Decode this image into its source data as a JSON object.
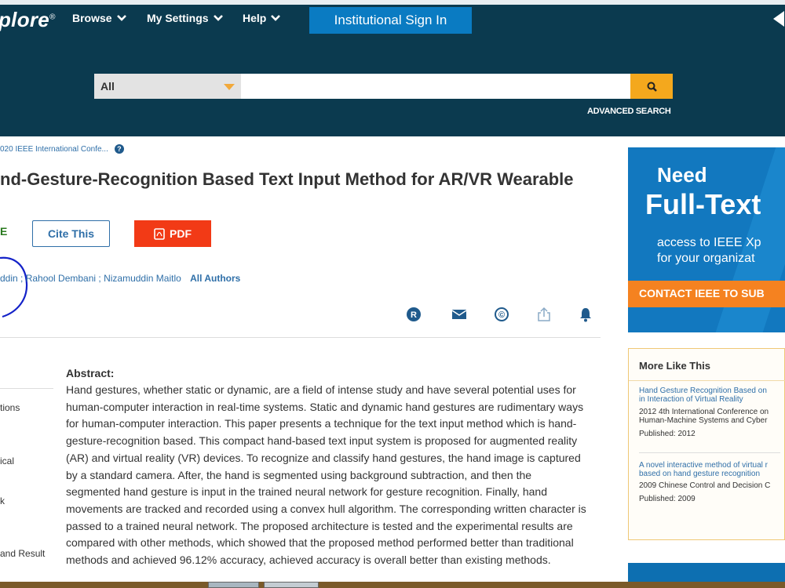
{
  "header": {
    "logo_text": "plore",
    "logo_mark": "®",
    "nav": [
      {
        "label": "Browse"
      },
      {
        "label": "My Settings"
      },
      {
        "label": "Help"
      }
    ],
    "signin_label": "Institutional Sign In",
    "search": {
      "scope_value": "All",
      "query_value": "",
      "advanced_label": "ADVANCED SEARCH"
    }
  },
  "breadcrumb": "020 IEEE International Confe...",
  "help_glyph": "?",
  "article": {
    "title": "nd-Gesture-Recognition Based Text Input Method for AR/VR Wearable",
    "access_label": "E",
    "cite_label": "Cite This",
    "pdf_label": "PDF",
    "authors": "ddin ; Rahool Dembani ; Nizamuddin Maitlo",
    "all_authors_label": "All Authors",
    "icons": [
      "rights-icon",
      "email-icon",
      "copyright-icon",
      "share-icon",
      "alert-bell-icon"
    ],
    "rights_glyph": "R",
    "copyright_glyph": "©"
  },
  "left_nav": [
    {
      "label": "tions"
    },
    {
      "label": "ical"
    },
    {
      "label": "k"
    },
    {
      "label": "and Result"
    }
  ],
  "abstract": {
    "heading": "Abstract:",
    "lines": [
      "Hand gestures, whether static or dynamic, are a field of intense study and have several potential uses for",
      "human-computer interaction in real-time systems. Static and dynamic hand gestures are rudimentary ways",
      "for human-computer interaction. This paper presents a technique for the text input method which is hand-",
      "gesture-recognition based. This compact hand-based text input system is proposed for augmented reality",
      "(AR) and virtual reality (VR) devices. To recognize and classify hand gestures, the hand image is captured",
      "by a standard camera. After, the hand is segmented using background subtraction, and then the",
      "segmented hand gesture is input in the trained neural network for gesture recognition. Finally, hand",
      "movements are tracked and recorded using a convex hull algorithm. The corresponding written character is",
      "passed to a trained neural network. The proposed architecture is tested and the experimental results are",
      "compared with other methods, which showed that the proposed method performed better than traditional",
      "methods and achieved 96.12% accuracy, achieved accuracy is overall better than existing methods."
    ]
  },
  "ad": {
    "need": "Need",
    "fulltext": "Full-Text",
    "line1": "access to IEEE Xp",
    "line2": "for your organizat",
    "cta": "CONTACT IEEE TO SUB"
  },
  "more_like_this": {
    "heading": "More Like This",
    "items": [
      {
        "title_lines": [
          "Hand Gesture Recognition Based on",
          "in Interaction of Virtual Reality"
        ],
        "venue_lines": [
          "2012 4th International Conference on",
          "Human-Machine Systems and Cyber"
        ],
        "published": "Published: 2012"
      },
      {
        "title_lines": [
          "A novel interactive method of virtual r",
          "based on hand gesture recognition"
        ],
        "venue_lines": [
          "2009 Chinese Control and Decision C"
        ],
        "published": "Published: 2009"
      }
    ]
  },
  "colors": {
    "header_bg": "#0b3a4f",
    "signin_bg": "#0a7bc2",
    "search_button": "#f4a81d",
    "pdf_button": "#f23a16",
    "link": "#2f6fa8",
    "ad_bg": "#1278bf",
    "ad_cta": "#f58220"
  }
}
